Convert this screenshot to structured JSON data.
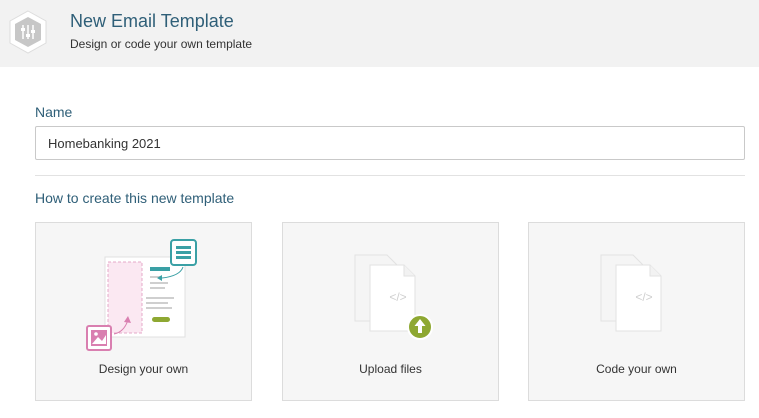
{
  "header": {
    "title": "New Email Template",
    "subtitle": "Design or code your own template",
    "icon": "sliders-icon"
  },
  "form": {
    "name_label": "Name",
    "name_value": "Homebanking 2021",
    "section_title": "How to create this new template"
  },
  "options": [
    {
      "label": "Design your own",
      "icon": "design-layout-icon"
    },
    {
      "label": "Upload files",
      "icon": "upload-file-icon"
    },
    {
      "label": "Code your own",
      "icon": "code-file-icon"
    }
  ],
  "colors": {
    "accent": "#2f5f78",
    "teal": "#3aa0a5",
    "pink": "#d97fb0",
    "green": "#8ea832"
  }
}
